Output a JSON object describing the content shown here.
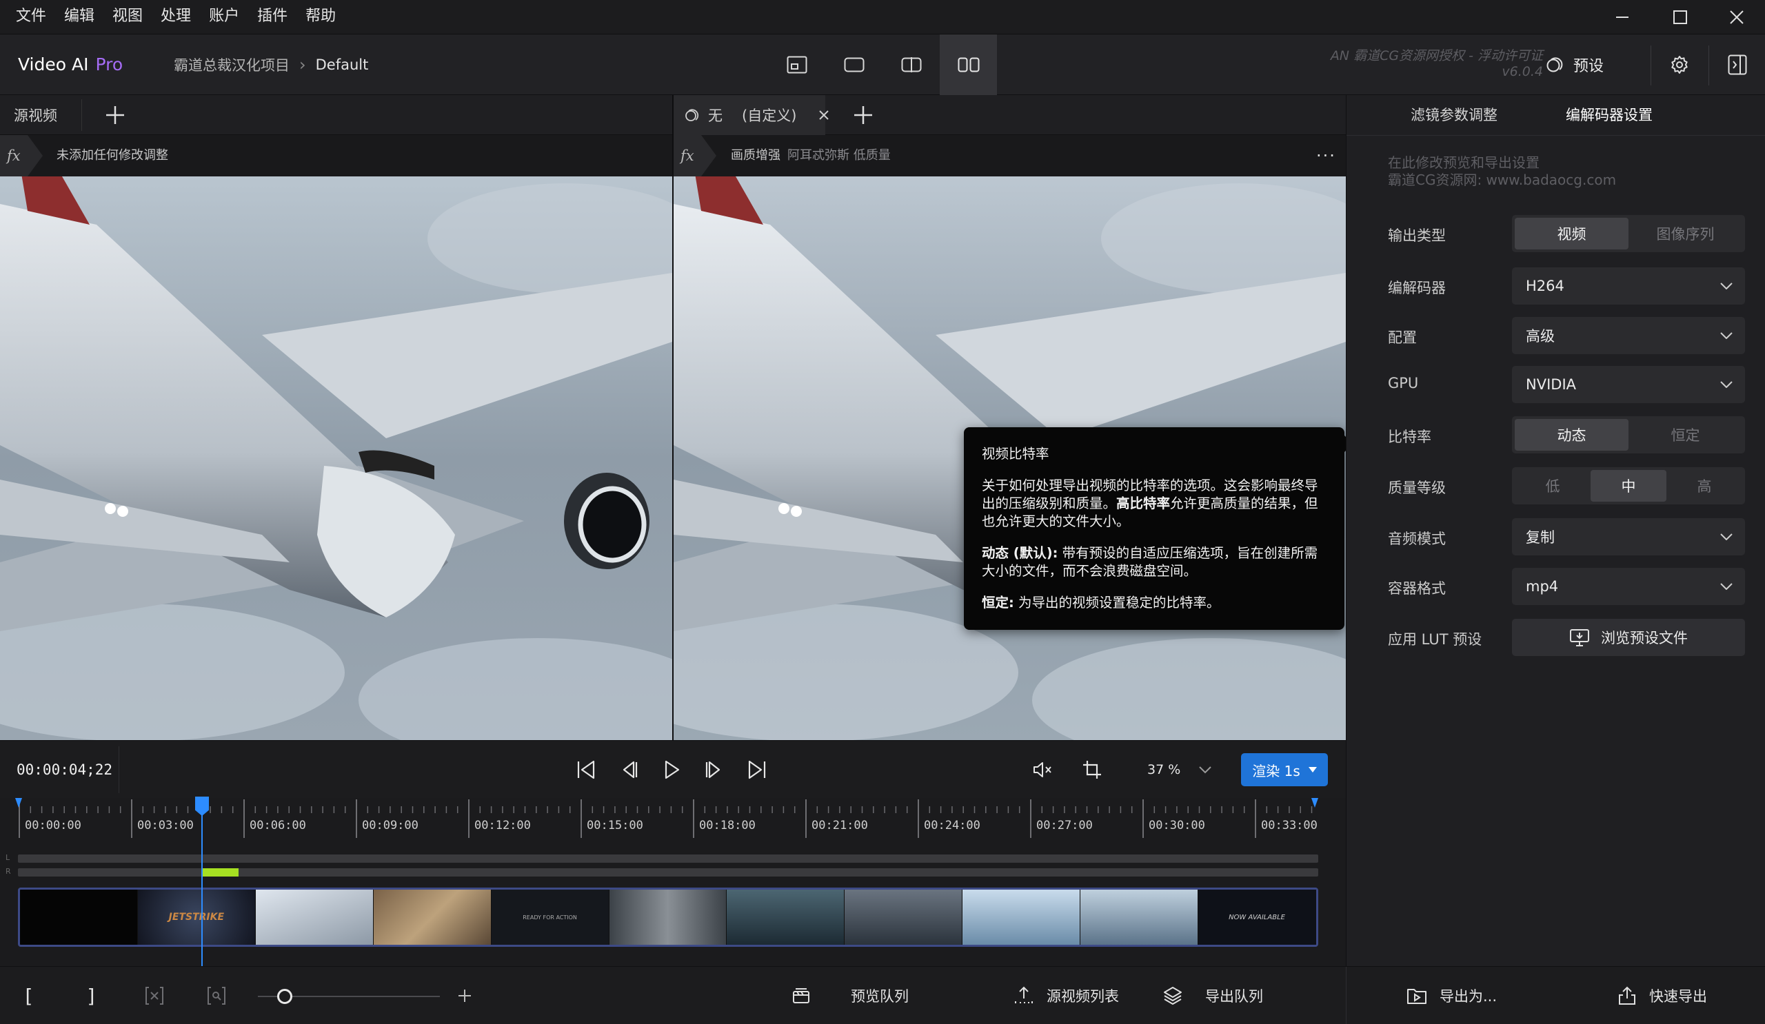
{
  "menu": [
    "文件",
    "编辑",
    "视图",
    "处理",
    "账户",
    "插件",
    "帮助"
  ],
  "header": {
    "app_name": "Video AI",
    "app_edition": "Pro",
    "project": "霸道总裁汉化项目",
    "preset_crumb": "Default",
    "license_line1": "AN 霸道CG资源网授权 - 浮动许可证",
    "license_line2": "v6.0.4",
    "preset_label": "预设"
  },
  "left_pane": {
    "tab_label": "源视频",
    "fx_label": "fx",
    "fx_text": "未添加任何修改调整"
  },
  "right_pane": {
    "tab_label": "无",
    "tab_suffix": "(自定义)",
    "fx_label": "fx",
    "fx_text": "画质增强",
    "fx_detail": "阿耳忒弥斯 低质量"
  },
  "controls": {
    "timecode": "00:00:04;22",
    "zoom": "37 %",
    "render_label": "渲染 1s"
  },
  "ruler": {
    "labels": [
      "00:00:00",
      "00:03:00",
      "00:06:00",
      "00:09:00",
      "00:12:00",
      "00:15:00",
      "00:18:00",
      "00:21:00",
      "00:24:00",
      "00:27:00",
      "00:30:00",
      "00:33:00"
    ],
    "channel_l": "L",
    "channel_r": "R"
  },
  "filmstrip": {
    "thumbnails": [
      "black",
      "jetstrike-title",
      "plane-white",
      "desert",
      "ready-for-action",
      "robot-arm",
      "city-dark",
      "jets-formation",
      "sky-missile",
      "jet-snow",
      "now-available"
    ],
    "thumb_text_1": "JETSTRIKE",
    "thumb_text_4": "READY FOR ACTION",
    "thumb_text_10": "NOW AVAILABLE"
  },
  "bottom": {
    "in_mark": "[",
    "out_mark": "]",
    "preview_queue": "预览队列",
    "source_list": "源视频列表",
    "export_queue": "导出队列",
    "export_as": "导出为...",
    "quick_export": "快速导出"
  },
  "panel": {
    "tab_filter": "滤镜参数调整",
    "tab_codec": "编解码器设置",
    "hint_line1": "在此修改预览和导出设置",
    "hint_line2": "霸道CG资源网: www.badaocg.com",
    "output_type_label": "输出类型",
    "output_type_options": [
      "视频",
      "图像序列"
    ],
    "codec_label": "编解码器",
    "codec_value": "H264",
    "profile_label": "配置",
    "profile_value": "高级",
    "gpu_label": "GPU",
    "gpu_value": "NVIDIA",
    "bitrate_label": "比特率",
    "bitrate_options": [
      "动态",
      "恒定"
    ],
    "quality_label": "质量等级",
    "quality_options": [
      "低",
      "中",
      "高"
    ],
    "audio_label": "音频模式",
    "audio_value": "复制",
    "container_label": "容器格式",
    "container_value": "mp4",
    "lut_label": "应用 LUT 预设",
    "lut_button": "浏览预设文件"
  },
  "tooltip": {
    "title": "视频比特率",
    "p1_a": "关于如何处理导出视频的比特率的选项。这会影响最终导出的压缩级别和质量。",
    "p1_b": "高比特率",
    "p1_c": "允许更高质量的结果，但也允许更大的文件大小。",
    "p2_b": "动态 (默认):",
    "p2_c": " 带有预设的自适应压缩选项，旨在创建所需大小的文件，而不会浪费磁盘空间。",
    "p3_b": "恒定:",
    "p3_c": " 为导出的视频设置稳定的比特率。"
  },
  "colors": {
    "accent_purple": "#a56cf5",
    "render_blue": "#1f74d8",
    "playhead_blue": "#2d8cff",
    "audio_green": "#a6e022"
  }
}
